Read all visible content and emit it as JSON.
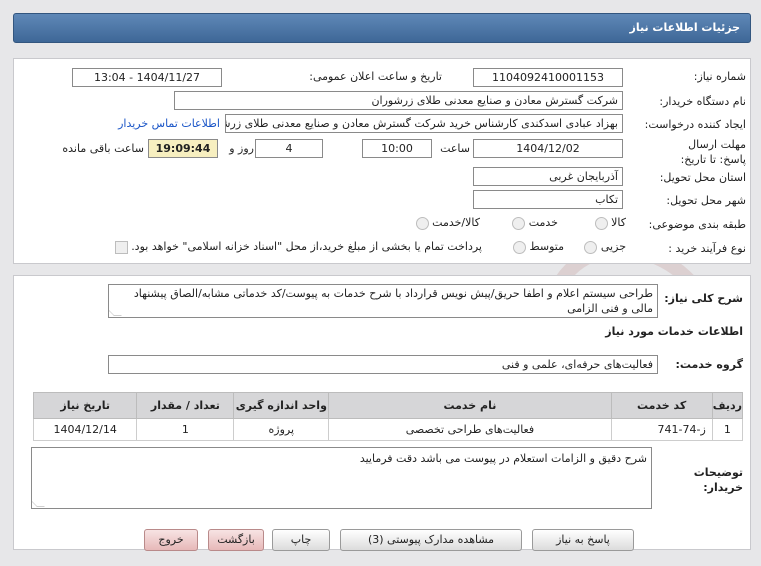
{
  "header": {
    "title": "جزئیات اطلاعات نیاز"
  },
  "labels": {
    "need_number": "شماره نیاز:",
    "announce_datetime": "تاریخ و ساعت اعلان عمومی:",
    "buyer_org": "نام دستگاه خریدار:",
    "requester": "ایجاد کننده درخواست:",
    "deadline": "مهلت ارسال پاسخ: تا تاریخ:",
    "time": "ساعت",
    "days_and": "روز و",
    "remaining": "ساعت باقی مانده",
    "province": "استان محل تحویل:",
    "city": "شهر محل تحویل:",
    "category": "طبقه بندی موضوعی:",
    "process": "نوع فرآیند خرید :",
    "description": "شرح کلی نیاز:",
    "services_info": "اطلاعات خدمات مورد نیاز",
    "service_group": "گروه خدمت:",
    "buyer_notes": "توضیحات خریدار:"
  },
  "fields": {
    "need_number": "1104092410001153",
    "announce_datetime": "1404/11/27 - 13:04",
    "buyer_org": "شرکت گسترش معادن و صنایع معدنی طلای زرشوران",
    "requester": "بهزاد عبادی اسدکندی کارشناس خرید  شرکت گسترش معادن و صنایع معدنی طلای زرشوران",
    "contact_link": "اطلاعات تماس خریدار",
    "deadline_date": "1404/12/02",
    "deadline_time": "10:00",
    "days": "4",
    "countdown": "19:09:44",
    "province": "آذربایجان غربی",
    "city": "تکاب",
    "description": "طراحی سیستم اعلام  و اطفا حریق/پیش نویس قرارداد با شرح خدمات به پیوست/کد خدماتی مشابه/الصاق پیشنهاد مالی و فنی الزامی",
    "service_group": "فعالیت‌های حرفه‌ای، علمی و فنی",
    "buyer_notes": "شرح دقیق و الزامات استعلام در پیوست می باشد دقت فرمایید"
  },
  "category_options": [
    "کالا",
    "خدمت",
    "کالا/خدمت"
  ],
  "process_options": [
    "جزیی",
    "متوسط"
  ],
  "process_note": "پرداخت تمام یا بخشی از مبلغ خرید،از محل \"اسناد خزانه اسلامی\" خواهد بود.",
  "table": {
    "headers": [
      "ردیف",
      "کد خدمت",
      "نام خدمت",
      "واحد اندازه گیری",
      "تعداد / مقدار",
      "تاریخ نیاز"
    ],
    "rows": [
      [
        "1",
        "ز-74-741",
        "فعالیت‌های طراحی تخصصی",
        "پروژه",
        "1",
        "1404/12/14"
      ]
    ]
  },
  "buttons": {
    "reply": "پاسخ به نیاز",
    "attachments": "مشاهده مدارک پیوستی (3)",
    "print": "چاپ",
    "back": "بازگشت",
    "exit": "خروج"
  },
  "watermark": "AriaTender.net",
  "colors": {
    "header": "#4a73a3",
    "countdown_bg": "#f7efc0",
    "link": "#1a55c7"
  }
}
